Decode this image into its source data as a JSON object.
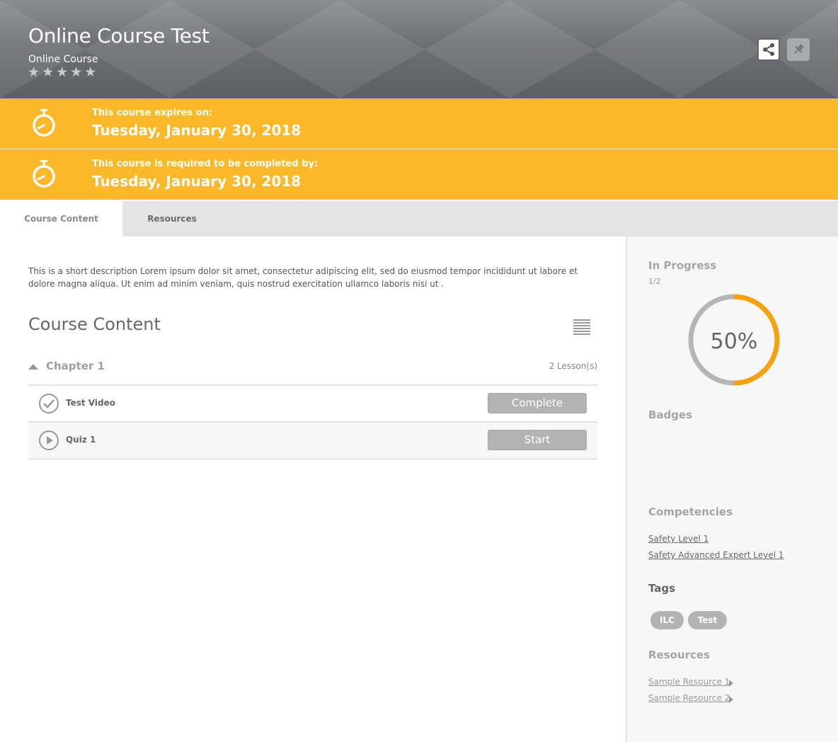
{
  "header": {
    "title": "Online Course Test",
    "type": "Online Course",
    "rating_stars": 5,
    "share_icon": "share-icon",
    "pin_icon": "pin-icon"
  },
  "banners": [
    {
      "label": "This course expires on:",
      "date": "Tuesday, January 30, 2018",
      "icon": "stopwatch-icon"
    },
    {
      "label": "This course is required to be completed by:",
      "date": "Tuesday, January 30, 2018",
      "icon": "stopwatch-icon"
    }
  ],
  "tabs": [
    {
      "label": "Course Content",
      "active": true
    },
    {
      "label": "Resources",
      "active": false
    }
  ],
  "main": {
    "description": "This is a short description Lorem ipsum dolor sit amet, consectetur adipiscing elit, sed do eiusmod tempor incididunt ut labore et dolore magna aliqua. Ut enim ad minim veniam, quis nostrud exercitation ullamco laboris nisi ut .",
    "section_title": "Course Content",
    "chapter": {
      "name": "Chapter 1",
      "lesson_count": "2 Lesson(s)",
      "lessons": [
        {
          "name": "Test Video",
          "button": "Complete",
          "icon": "check-circle-icon"
        },
        {
          "name": "Quiz 1",
          "button": "Start",
          "icon": "play-circle-icon"
        }
      ]
    }
  },
  "sidebar": {
    "status": "In Progress",
    "progress_fraction": "1/2",
    "progress_percent_label": "50%",
    "progress_value": 0.5,
    "badges_heading": "Badges",
    "competencies_heading": "Competencies",
    "competencies": [
      "Safety Level 1",
      "Safety Advanced Expert Level 1"
    ],
    "tags_heading": "Tags",
    "tags": [
      "ILC",
      "Test"
    ],
    "resources_heading": "Resources",
    "resources": [
      "Sample Resource 1",
      "Sample Resource 2"
    ]
  },
  "colors": {
    "accent": "#fbb829",
    "progress": "#f5a20f",
    "ring_track": "#b5b5b5",
    "button": "#b3b3b3"
  }
}
